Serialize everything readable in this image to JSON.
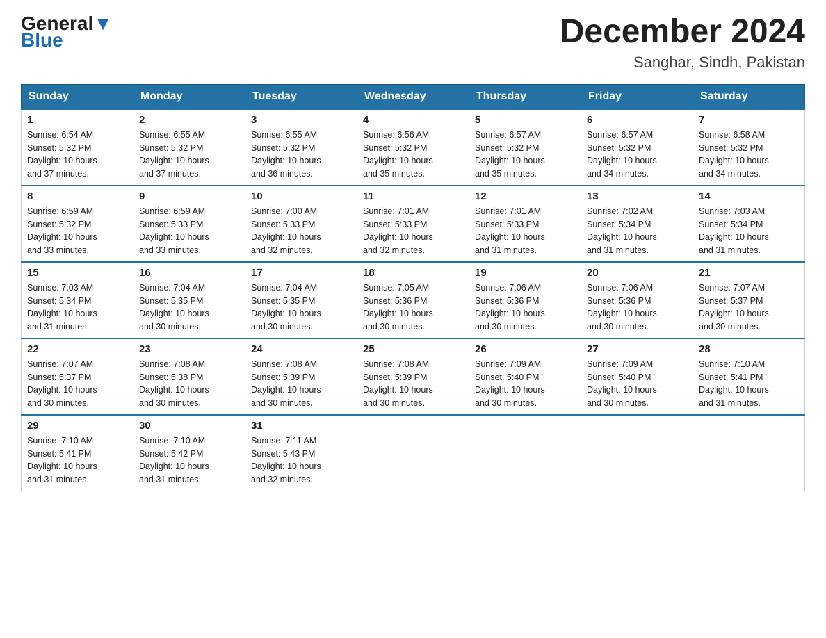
{
  "logo": {
    "top": "General",
    "bottom": "Blue"
  },
  "title": "December 2024",
  "subtitle": "Sanghar, Sindh, Pakistan",
  "weekdays": [
    "Sunday",
    "Monday",
    "Tuesday",
    "Wednesday",
    "Thursday",
    "Friday",
    "Saturday"
  ],
  "weeks": [
    [
      {
        "day": "1",
        "sunrise": "6:54 AM",
        "sunset": "5:32 PM",
        "daylight": "10 hours and 37 minutes."
      },
      {
        "day": "2",
        "sunrise": "6:55 AM",
        "sunset": "5:32 PM",
        "daylight": "10 hours and 37 minutes."
      },
      {
        "day": "3",
        "sunrise": "6:55 AM",
        "sunset": "5:32 PM",
        "daylight": "10 hours and 36 minutes."
      },
      {
        "day": "4",
        "sunrise": "6:56 AM",
        "sunset": "5:32 PM",
        "daylight": "10 hours and 35 minutes."
      },
      {
        "day": "5",
        "sunrise": "6:57 AM",
        "sunset": "5:32 PM",
        "daylight": "10 hours and 35 minutes."
      },
      {
        "day": "6",
        "sunrise": "6:57 AM",
        "sunset": "5:32 PM",
        "daylight": "10 hours and 34 minutes."
      },
      {
        "day": "7",
        "sunrise": "6:58 AM",
        "sunset": "5:32 PM",
        "daylight": "10 hours and 34 minutes."
      }
    ],
    [
      {
        "day": "8",
        "sunrise": "6:59 AM",
        "sunset": "5:32 PM",
        "daylight": "10 hours and 33 minutes."
      },
      {
        "day": "9",
        "sunrise": "6:59 AM",
        "sunset": "5:33 PM",
        "daylight": "10 hours and 33 minutes."
      },
      {
        "day": "10",
        "sunrise": "7:00 AM",
        "sunset": "5:33 PM",
        "daylight": "10 hours and 32 minutes."
      },
      {
        "day": "11",
        "sunrise": "7:01 AM",
        "sunset": "5:33 PM",
        "daylight": "10 hours and 32 minutes."
      },
      {
        "day": "12",
        "sunrise": "7:01 AM",
        "sunset": "5:33 PM",
        "daylight": "10 hours and 31 minutes."
      },
      {
        "day": "13",
        "sunrise": "7:02 AM",
        "sunset": "5:34 PM",
        "daylight": "10 hours and 31 minutes."
      },
      {
        "day": "14",
        "sunrise": "7:03 AM",
        "sunset": "5:34 PM",
        "daylight": "10 hours and 31 minutes."
      }
    ],
    [
      {
        "day": "15",
        "sunrise": "7:03 AM",
        "sunset": "5:34 PM",
        "daylight": "10 hours and 31 minutes."
      },
      {
        "day": "16",
        "sunrise": "7:04 AM",
        "sunset": "5:35 PM",
        "daylight": "10 hours and 30 minutes."
      },
      {
        "day": "17",
        "sunrise": "7:04 AM",
        "sunset": "5:35 PM",
        "daylight": "10 hours and 30 minutes."
      },
      {
        "day": "18",
        "sunrise": "7:05 AM",
        "sunset": "5:36 PM",
        "daylight": "10 hours and 30 minutes."
      },
      {
        "day": "19",
        "sunrise": "7:06 AM",
        "sunset": "5:36 PM",
        "daylight": "10 hours and 30 minutes."
      },
      {
        "day": "20",
        "sunrise": "7:06 AM",
        "sunset": "5:36 PM",
        "daylight": "10 hours and 30 minutes."
      },
      {
        "day": "21",
        "sunrise": "7:07 AM",
        "sunset": "5:37 PM",
        "daylight": "10 hours and 30 minutes."
      }
    ],
    [
      {
        "day": "22",
        "sunrise": "7:07 AM",
        "sunset": "5:37 PM",
        "daylight": "10 hours and 30 minutes."
      },
      {
        "day": "23",
        "sunrise": "7:08 AM",
        "sunset": "5:38 PM",
        "daylight": "10 hours and 30 minutes."
      },
      {
        "day": "24",
        "sunrise": "7:08 AM",
        "sunset": "5:39 PM",
        "daylight": "10 hours and 30 minutes."
      },
      {
        "day": "25",
        "sunrise": "7:08 AM",
        "sunset": "5:39 PM",
        "daylight": "10 hours and 30 minutes."
      },
      {
        "day": "26",
        "sunrise": "7:09 AM",
        "sunset": "5:40 PM",
        "daylight": "10 hours and 30 minutes."
      },
      {
        "day": "27",
        "sunrise": "7:09 AM",
        "sunset": "5:40 PM",
        "daylight": "10 hours and 30 minutes."
      },
      {
        "day": "28",
        "sunrise": "7:10 AM",
        "sunset": "5:41 PM",
        "daylight": "10 hours and 31 minutes."
      }
    ],
    [
      {
        "day": "29",
        "sunrise": "7:10 AM",
        "sunset": "5:41 PM",
        "daylight": "10 hours and 31 minutes."
      },
      {
        "day": "30",
        "sunrise": "7:10 AM",
        "sunset": "5:42 PM",
        "daylight": "10 hours and 31 minutes."
      },
      {
        "day": "31",
        "sunrise": "7:11 AM",
        "sunset": "5:43 PM",
        "daylight": "10 hours and 32 minutes."
      },
      null,
      null,
      null,
      null
    ]
  ],
  "labels": {
    "sunrise": "Sunrise:",
    "sunset": "Sunset:",
    "daylight": "Daylight:"
  }
}
